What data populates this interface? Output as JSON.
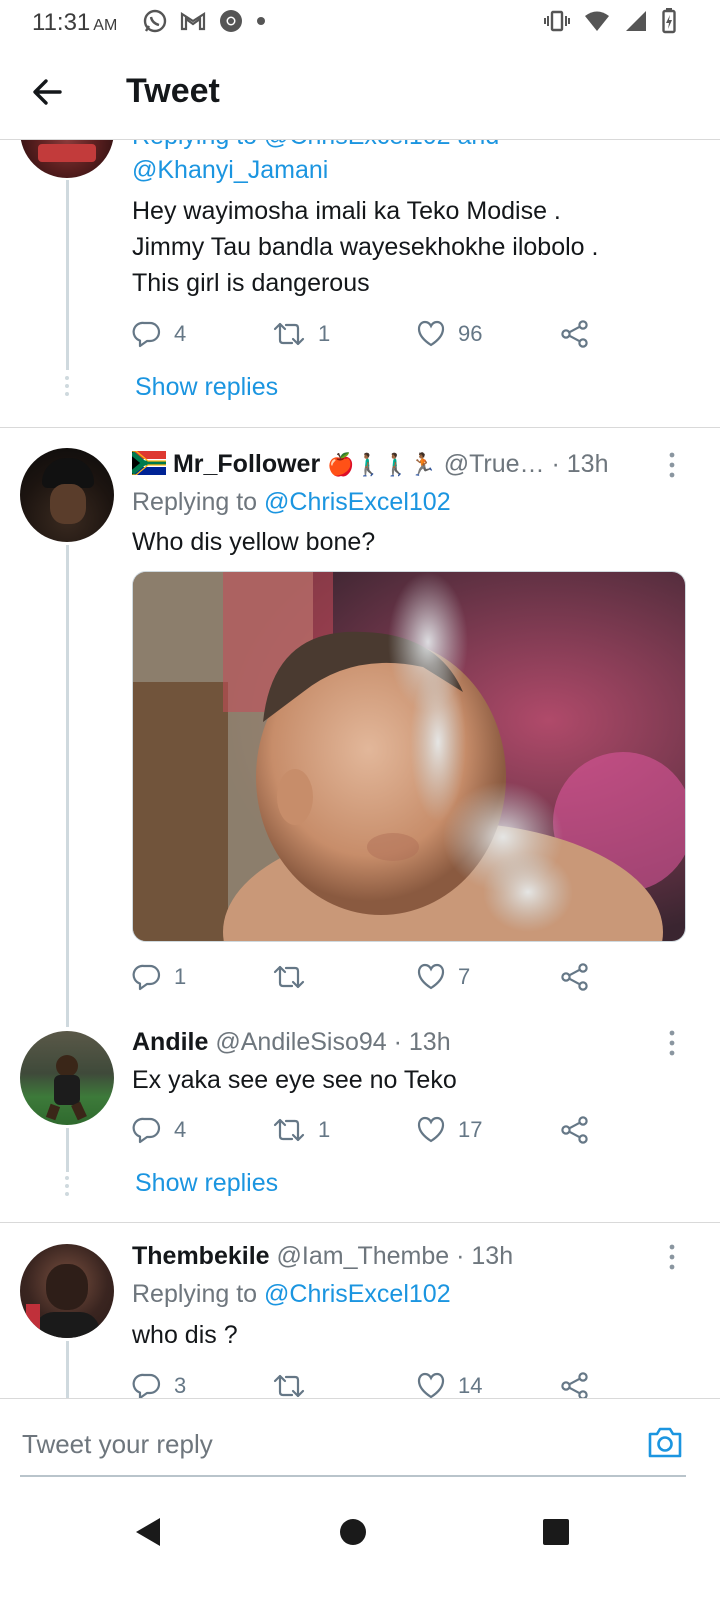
{
  "status_bar": {
    "time": "11:31",
    "ampm": "AM"
  },
  "header": {
    "title": "Tweet"
  },
  "tweets": [
    {
      "replying_to_hidden": "Replying to @ChrisExcel102 and",
      "mention_line": "@Khanyi_Jamani",
      "text_lines": [
        "Hey wayimosha imali ka Teko Modise .",
        "Jimmy Tau bandla wayesekhokhe ilobolo .",
        "This girl is dangerous"
      ],
      "replies": "4",
      "retweets": "1",
      "likes": "96",
      "show_replies": "Show replies"
    },
    {
      "name": "Mr_Follower",
      "emoji": "🍎🚶🏾‍♂️🚶🏾‍♂️🏃🏾",
      "handle_time": "@True… · 13h",
      "replying_prefix": "Replying to ",
      "replying_handle": "@ChrisExcel102",
      "text": "Who dis yellow bone?",
      "replies": "1",
      "retweets": "",
      "likes": "7"
    },
    {
      "name": "Andile",
      "handle_time": "@AndileSiso94 · 13h",
      "text": "Ex yaka see eye see no Teko",
      "replies": "4",
      "retweets": "1",
      "likes": "17",
      "show_replies": "Show replies"
    },
    {
      "name": "Thembekile",
      "handle_time": "@Iam_Thembe · 13h",
      "replying_prefix": "Replying to ",
      "replying_handle": "@ChrisExcel102",
      "text": "who dis ?",
      "replies": "3",
      "retweets": "",
      "likes": "14"
    }
  ],
  "reply_box": {
    "placeholder": "Tweet your reply"
  },
  "colors": {
    "accent": "#1b95e0",
    "muted": "#657786",
    "text": "#14171a"
  },
  "icons": [
    "back-arrow-icon",
    "reply-icon",
    "retweet-icon",
    "like-icon",
    "share-icon",
    "more-icon",
    "camera-icon"
  ]
}
